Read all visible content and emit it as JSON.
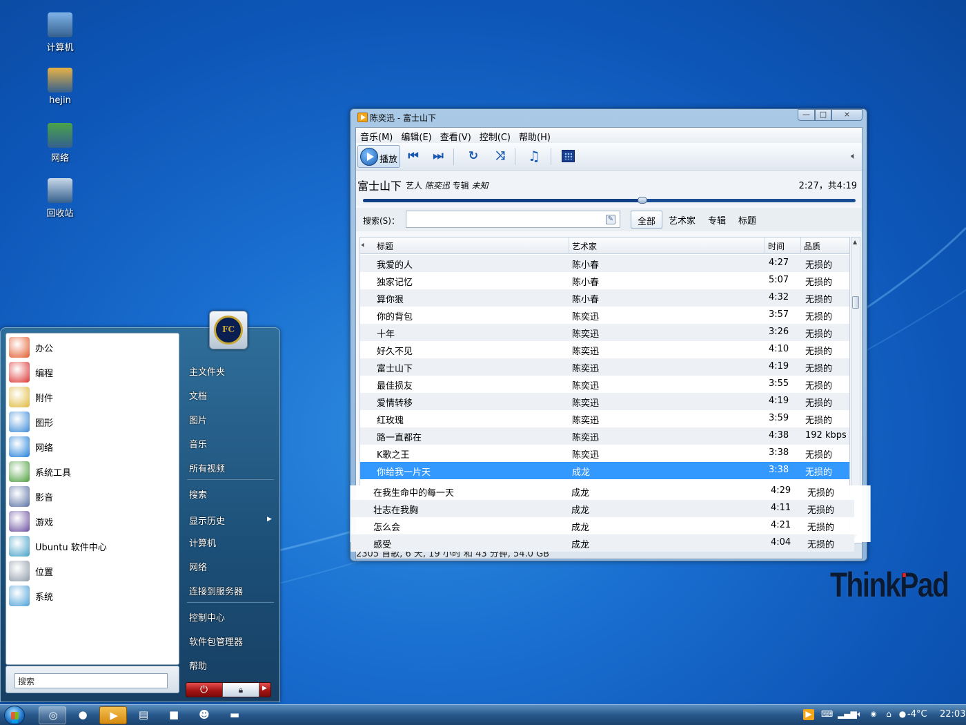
{
  "desktop": {
    "icons": [
      {
        "label": "计算机",
        "icon": "computer-icon"
      },
      {
        "label": "hejin",
        "icon": "user-folder-icon"
      },
      {
        "label": "网络",
        "icon": "network-icon"
      },
      {
        "label": "回收站",
        "icon": "recycle-bin-icon"
      }
    ],
    "brand": "ThinkPad"
  },
  "player": {
    "window_title": "陈奕迅 - 富士山下",
    "window_controls": {
      "minimize": "—",
      "maximize": "□",
      "close": "×"
    },
    "menu": [
      "音乐(M)",
      "编辑(E)",
      "查看(V)",
      "控制(C)",
      "帮助(H)"
    ],
    "toolbar": {
      "play_label": "播放",
      "buttons": [
        "previous-icon",
        "next-icon",
        "repeat-icon",
        "shuffle-icon",
        "music-note-icon",
        "visualizer-icon",
        "volume-icon"
      ]
    },
    "now_playing": {
      "title": "富士山下",
      "artist_label": "艺人",
      "artist": "陈奕迅",
      "album_label": "专辑",
      "album": "未知",
      "time": "2:27，共4:19",
      "progress": 0.567
    },
    "search": {
      "label": "搜索(S)：",
      "value": "",
      "filters": [
        "全部",
        "艺术家",
        "专辑",
        "标题"
      ],
      "active_filter": 0
    },
    "columns": {
      "title": "标题",
      "artist": "艺术家",
      "time": "时间",
      "quality": "品质"
    },
    "tracks": [
      {
        "title": "我爱的人",
        "artist": "陈小春",
        "time": "4:27",
        "quality": "无损的"
      },
      {
        "title": "独家记忆",
        "artist": "陈小春",
        "time": "5:07",
        "quality": "无损的"
      },
      {
        "title": "算你狠",
        "artist": "陈小春",
        "time": "4:32",
        "quality": "无损的"
      },
      {
        "title": "你的背包",
        "artist": "陈奕迅",
        "time": "3:57",
        "quality": "无损的"
      },
      {
        "title": "十年",
        "artist": "陈奕迅",
        "time": "3:26",
        "quality": "无损的"
      },
      {
        "title": "好久不见",
        "artist": "陈奕迅",
        "time": "4:10",
        "quality": "无损的"
      },
      {
        "title": "富士山下",
        "artist": "陈奕迅",
        "time": "4:19",
        "quality": "无损的"
      },
      {
        "title": "最佳损友",
        "artist": "陈奕迅",
        "time": "3:55",
        "quality": "无损的"
      },
      {
        "title": "爱情转移",
        "artist": "陈奕迅",
        "time": "4:19",
        "quality": "无损的"
      },
      {
        "title": "红玫瑰",
        "artist": "陈奕迅",
        "time": "3:59",
        "quality": "无损的"
      },
      {
        "title": "路一直都在",
        "artist": "陈奕迅",
        "time": "4:38",
        "quality": "192 kbps"
      },
      {
        "title": "K歌之王",
        "artist": "陈奕迅",
        "time": "3:38",
        "quality": "无损的"
      },
      {
        "title": "你给我一片天",
        "artist": "成龙",
        "time": "3:38",
        "quality": "无损的"
      }
    ],
    "selected_index": 12,
    "overflow_tracks": [
      {
        "title": "在我生命中的每一天",
        "artist": "成龙",
        "time": "4:29",
        "quality": "无损的"
      },
      {
        "title": "壮志在我胸",
        "artist": "成龙",
        "time": "4:11",
        "quality": "无损的"
      },
      {
        "title": "怎么会",
        "artist": "成龙",
        "time": "4:21",
        "quality": "无损的"
      },
      {
        "title": "感受",
        "artist": "成龙",
        "time": "4:04",
        "quality": "无损的"
      }
    ],
    "status": "2305 首歌, 6 天, 19 小时 和 43 分钟, 54.0 GB"
  },
  "start_menu": {
    "left_items": [
      {
        "label": "办公",
        "icon": "office-icon"
      },
      {
        "label": "编程",
        "icon": "programming-icon"
      },
      {
        "label": "附件",
        "icon": "accessories-icon"
      },
      {
        "label": "图形",
        "icon": "graphics-icon"
      },
      {
        "label": "网络",
        "icon": "internet-icon"
      },
      {
        "label": "系统工具",
        "icon": "system-tools-icon"
      },
      {
        "label": "影音",
        "icon": "multimedia-icon"
      },
      {
        "label": "游戏",
        "icon": "games-icon"
      },
      {
        "label": "Ubuntu 软件中心",
        "icon": "software-center-icon"
      },
      {
        "label": "位置",
        "icon": "places-icon"
      },
      {
        "label": "系统",
        "icon": "system-icon"
      }
    ],
    "search_placeholder": "搜索",
    "right_items": [
      "主文件夹",
      "文档",
      "图片",
      "音乐",
      "所有视频",
      "搜索",
      "显示历史",
      "计算机",
      "网络",
      "连接到服务器",
      "控制中心",
      "软件包管理器",
      "帮助"
    ]
  },
  "taskbar": {
    "tasks": [
      {
        "name": "browser-task",
        "icon": "globe-icon",
        "glyph": "◎"
      },
      {
        "name": "qq-task",
        "icon": "penguin-icon",
        "glyph": "●"
      },
      {
        "name": "music-player-task",
        "icon": "player-icon",
        "glyph": "▶"
      },
      {
        "name": "notes-task",
        "icon": "notepad-icon",
        "glyph": "▤"
      },
      {
        "name": "terminal-task",
        "icon": "terminal-icon",
        "glyph": "■"
      },
      {
        "name": "contacts-task",
        "icon": "people-icon",
        "glyph": "☻"
      },
      {
        "name": "files-task",
        "icon": "folder-icon",
        "glyph": "▬"
      }
    ],
    "tray": {
      "weather": "-4°C",
      "clock": "22:03"
    }
  },
  "colors": {
    "selection": "#3399ff",
    "desktop": "#1a6fd0",
    "taskbar": "#27578a"
  }
}
